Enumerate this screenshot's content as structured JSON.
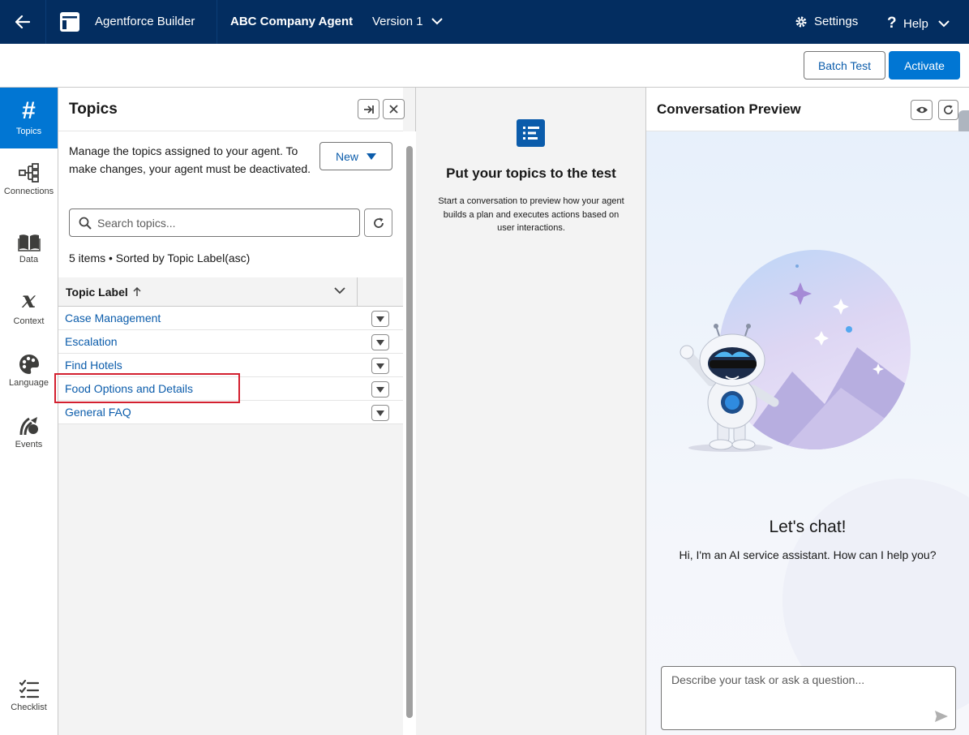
{
  "topbar": {
    "app_name": "Agentforce Builder",
    "agent_name": "ABC Company Agent",
    "version": "Version 1",
    "settings": "Settings",
    "help": "Help",
    "background": "#032d60"
  },
  "actions": {
    "batch_test": "Batch Test",
    "activate": "Activate"
  },
  "rail": {
    "items": [
      {
        "label": "Topics",
        "icon": "hash-icon",
        "active": true
      },
      {
        "label": "Connections",
        "icon": "hierarchy-icon"
      },
      {
        "label": "Data",
        "icon": "book-icon"
      },
      {
        "label": "Context",
        "icon": "variable-icon"
      },
      {
        "label": "Language",
        "icon": "palette-icon"
      },
      {
        "label": "Events",
        "icon": "events-icon"
      },
      {
        "label": "Checklist",
        "icon": "checklist-icon"
      }
    ]
  },
  "topics": {
    "title": "Topics",
    "description": "Manage the topics assigned to your agent. To make changes, your agent must be deactivated.",
    "new_label": "New",
    "search_placeholder": "Search topics...",
    "count": "5 items • Sorted by Topic Label(asc)",
    "column_label": "Topic Label",
    "rows": [
      "Case Management",
      "Escalation",
      "Find Hotels",
      "Food Options and Details",
      "General FAQ"
    ],
    "highlighted_row": "Food Options and Details"
  },
  "middle": {
    "title": "Put your topics to the test",
    "text": "Start a conversation to preview how your agent builds a plan and executes actions based on user interactions."
  },
  "preview": {
    "title": "Conversation Preview",
    "greeting": "Let's chat!",
    "intro": "Hi, I'm an AI service assistant. How can I help you?",
    "input_placeholder": "Describe your task or ask a question..."
  },
  "colors": {
    "brand": "#0176d3",
    "link": "#0b5cab",
    "highlight": "#d3202f"
  }
}
